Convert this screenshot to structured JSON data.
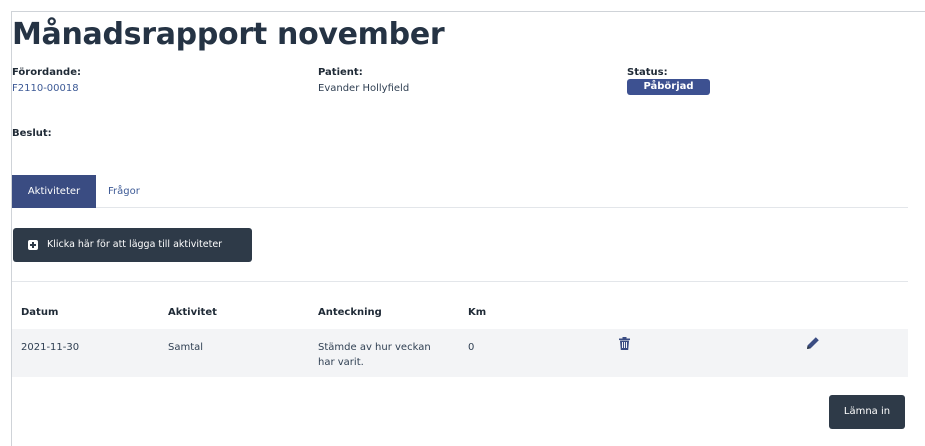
{
  "page": {
    "title": "Månadsrapport november"
  },
  "info": {
    "forordande_label": "Förordande:",
    "forordande_value": "F2110-00018",
    "patient_label": "Patient:",
    "patient_value": "Evander Hollyfield",
    "status_label": "Status:",
    "status_value": "Påbörjad",
    "beslut_label": "Beslut:"
  },
  "tabs": [
    {
      "label": "Aktiviteter",
      "active": true
    },
    {
      "label": "Frågor",
      "active": false
    }
  ],
  "actions": {
    "add_activity_label": "Klicka här för att lägga till aktiviteter",
    "submit_label": "Lämna in"
  },
  "table": {
    "headers": [
      "Datum",
      "Aktivitet",
      "Anteckning",
      "Km"
    ],
    "rows": [
      {
        "datum": "2021-11-30",
        "aktivitet": "Samtal",
        "anteckning": "Stämde av hur veckan har varit.",
        "km": "0",
        "delete_icon": "trash-icon",
        "edit_icon": "pencil-icon"
      }
    ]
  },
  "colors": {
    "primary_dark": "#2e3a48",
    "accent_blue": "#3a4c82",
    "badge_blue": "#3d5191",
    "link_blue": "#3d5a96",
    "row_bg": "#f3f4f6"
  }
}
